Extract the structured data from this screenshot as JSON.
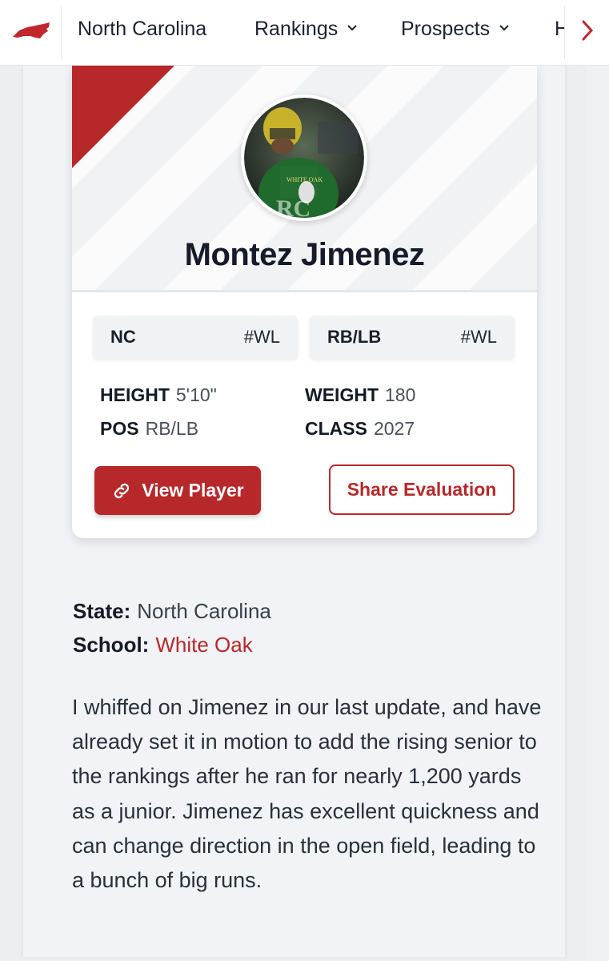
{
  "nav": {
    "items": [
      {
        "label": "North Carolina"
      },
      {
        "label": "Rankings",
        "chevron": "chevron-down-icon"
      },
      {
        "label": "Prospects",
        "chevron": "chevron-down-icon"
      },
      {
        "label": "H"
      }
    ],
    "next_icon": "chevron-right-icon",
    "logo_icon": "north-carolina-state-icon"
  },
  "colors": {
    "accent": "#b7282a",
    "dark_text": "#171a2b",
    "background": "#eff1f4"
  },
  "player": {
    "name": "Montez Jimenez",
    "state_chip": {
      "label": "NC",
      "rank": "#WL"
    },
    "position_chip": {
      "label": "RB/LB",
      "rank": "#WL"
    },
    "stats": {
      "height_label": "HEIGHT",
      "height": "5'10\"",
      "weight_label": "WEIGHT",
      "weight": "180",
      "pos_label": "POS",
      "pos": "RB/LB",
      "class_label": "CLASS",
      "class": "2027"
    },
    "view_button": "View Player",
    "share_button": "Share Evaluation"
  },
  "info": {
    "state_label": "State:",
    "state": "North Carolina",
    "school_label": "School:",
    "school": "White Oak"
  },
  "evaluation": "I whiffed on Jimenez in our last update, and have already set it in motion to add the rising senior to the rankings after he ran for nearly 1,200 yards as a junior. Jimenez has excellent quickness and can change direction in the open field, leading to a bunch of big runs."
}
